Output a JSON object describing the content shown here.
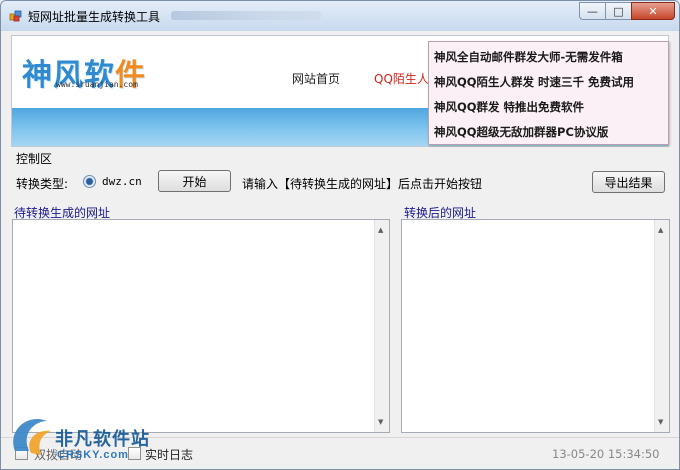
{
  "window": {
    "title": "短网址批量生成转换工具",
    "buttons": {
      "minimize": "—",
      "maximize": "□",
      "close": "✕"
    }
  },
  "banner": {
    "logo_main": "神风软",
    "logo_accent": "件",
    "logo_url": "www.sruanjian.com",
    "nav_home": "网站首页",
    "nav_qq": "QQ陌生人"
  },
  "ad_popup": {
    "items": [
      "神风全自动邮件群发大师-无需发件箱",
      "神风QQ陌生人群发 时速三千 免费试用",
      "神风QQ群发 特推出免费软件",
      "神风QQ超级无敌加群器PC协议版"
    ]
  },
  "controls": {
    "group_label": "控制区",
    "convert_type_label": "转换类型:",
    "radio_option": "dwz.cn",
    "start_button": "开始",
    "hint": "请输入【待转换生成的网址】后点击开始按钮",
    "export_button": "导出结果"
  },
  "panes": {
    "left_title": "待转换生成的网址",
    "right_title": "转换后的网址"
  },
  "status": {
    "autodial": "双拨自动",
    "log": "实时日志",
    "timestamp": "13-05-20 15:34:50"
  },
  "watermark": {
    "line1": "非凡软件站",
    "line2": "CRSKY.com"
  },
  "colors": {
    "accent_blue": "#2f8ad0",
    "accent_orange": "#f08b1f",
    "nav_red": "#d0261b",
    "popup_bg": "#fbf0f6"
  }
}
